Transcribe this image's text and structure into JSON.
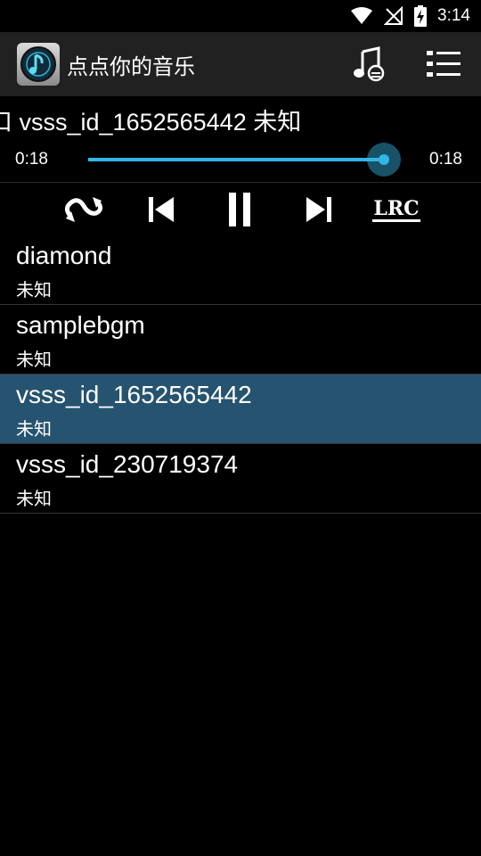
{
  "status_bar": {
    "time": "3:14"
  },
  "app_bar": {
    "title": "点点你的音乐"
  },
  "now_playing": {
    "ticker_text": "口                vsss_id_1652565442  未知"
  },
  "player": {
    "elapsed": "0:18",
    "duration": "0:18",
    "progress": 1.0,
    "accent_color": "#33b5e5"
  },
  "controls": {
    "icons": [
      "repeat-icon",
      "previous-icon",
      "pause-icon",
      "next-icon",
      "lyrics-icon"
    ],
    "lyrics_label": "LRC"
  },
  "songs": [
    {
      "title": "diamond",
      "artist": "未知",
      "selected": false
    },
    {
      "title": "samplebgm",
      "artist": "未知",
      "selected": false
    },
    {
      "title": "vsss_id_1652565442",
      "artist": "未知",
      "selected": true
    },
    {
      "title": "vsss_id_230719374",
      "artist": "未知",
      "selected": false
    }
  ],
  "colors": {
    "app_bar": "#212121",
    "selected_row": "#26536f",
    "background": "#000000"
  }
}
